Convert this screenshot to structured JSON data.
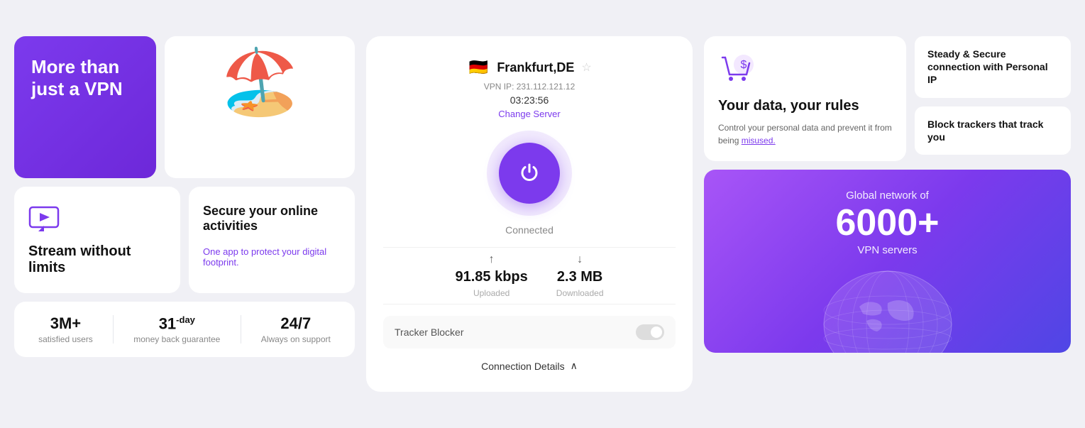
{
  "left": {
    "purple_card": {
      "title": "More than just a VPN"
    },
    "stream_card": {
      "title": "Stream without limits"
    },
    "secure_card": {
      "title": "Secure your online activities",
      "desc": "One app to protect your digital footprint."
    },
    "stats": [
      {
        "value": "3M+",
        "label": "satisfied users"
      },
      {
        "value": "31",
        "suffix": "-day",
        "label": "money back guarantee"
      },
      {
        "value": "24/7",
        "label": "Always on support"
      }
    ]
  },
  "center": {
    "server": {
      "flag": "🇩🇪",
      "name": "Frankfurt,DE",
      "ip_label": "VPN IP: 231.112.121.12",
      "timer": "03:23:56",
      "change_server": "Change Server"
    },
    "power": {
      "status": "Connected"
    },
    "upload": {
      "value": "91.85 kbps",
      "label": "Uploaded"
    },
    "download": {
      "value": "2.3 MB",
      "label": "Downloaded"
    },
    "tracker_blocker": {
      "label": "Tracker Blocker"
    },
    "connection_details": "Connection Details"
  },
  "right": {
    "data_rules": {
      "title": "Your data, your rules",
      "desc": "Control your personal data and prevent it from being misused.",
      "link_text": "misused."
    },
    "steady_card": {
      "title": "Steady & Secure connection with Personal IP"
    },
    "block_card": {
      "title": "Block trackers that track you"
    },
    "global": {
      "title": "Global network of",
      "number": "6000+",
      "subtitle": "VPN servers"
    }
  },
  "icons": {
    "star": "☆",
    "power": "⏻",
    "upload_arrow": "↑",
    "download_arrow": "↓",
    "chevron_up": "∧"
  }
}
